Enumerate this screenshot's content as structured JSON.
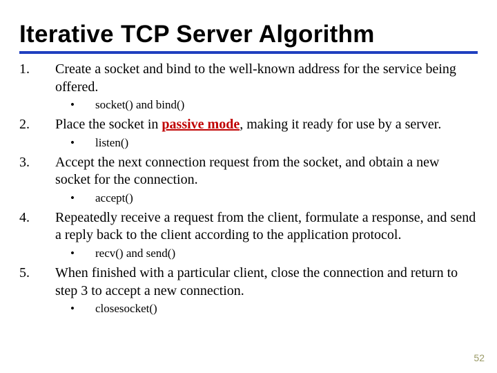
{
  "title": "Iterative TCP Server Algorithm",
  "items": [
    {
      "num": "1.",
      "text_a": "Create a socket and bind to the well-known address for the service being offered.",
      "sub": "socket() and bind()"
    },
    {
      "num": "2.",
      "text_a": "Place the socket in ",
      "highlight": "passive mode",
      "text_b": ", making it ready for use by a server.",
      "sub": "listen()"
    },
    {
      "num": "3.",
      "text_a": "Accept the next connection request from the socket, and obtain a new socket for the connection.",
      "sub": "accept()"
    },
    {
      "num": "4.",
      "text_a": "Repeatedly receive a request from the client, formulate a response, and send a reply back to the client according to the application protocol.",
      "sub": "recv() and send()"
    },
    {
      "num": "5.",
      "text_a": "When finished with a particular client, close the connection and return to step 3 to accept a new connection.",
      "sub": "closesocket()"
    }
  ],
  "page_number": "52"
}
